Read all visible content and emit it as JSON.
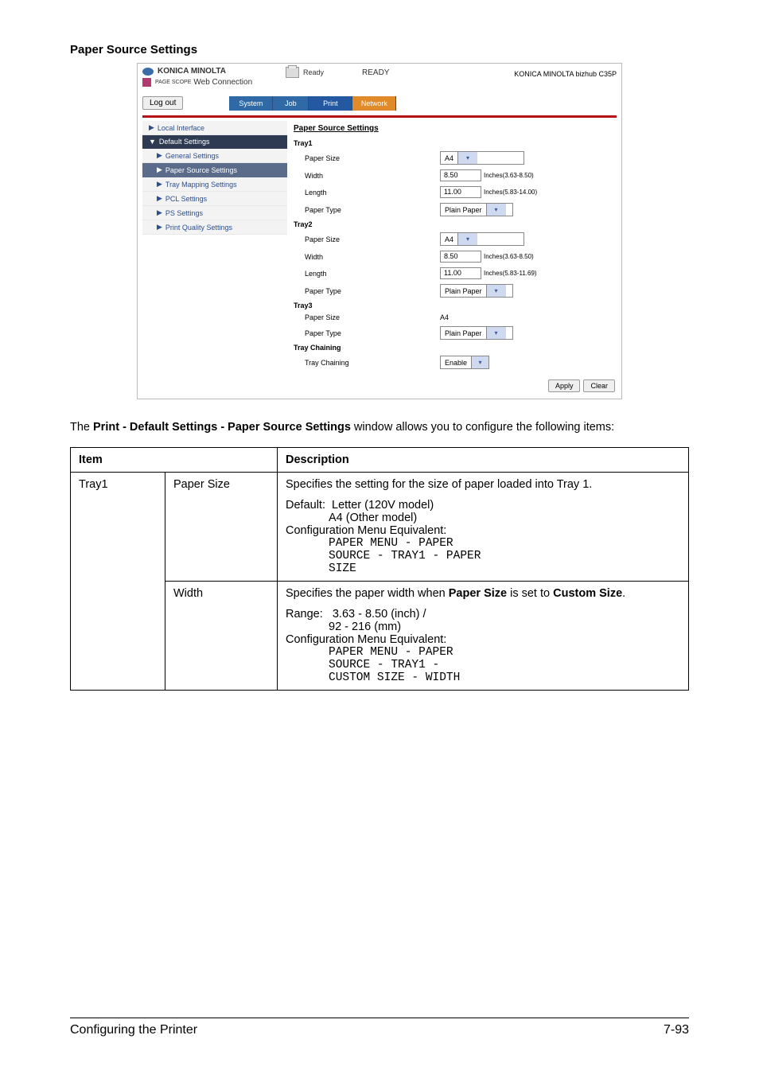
{
  "heading": "Paper Source Settings",
  "shot": {
    "brand": "KONICA MINOLTA",
    "pagescope_label1": "PAGE SCOPE",
    "pagescope_label2": "Web Connection",
    "ready1": "Ready",
    "ready2": "READY",
    "device": "KONICA MINOLTA bizhub C35P",
    "logout": "Log out",
    "tabs": {
      "system": "System",
      "job": "Job",
      "print": "Print",
      "network": "Network"
    },
    "nav": {
      "local": "Local Interface",
      "default": "Default Settings",
      "general": "General Settings",
      "psrc": "Paper Source Settings",
      "traymap": "Tray Mapping Settings",
      "pcl": "PCL Settings",
      "ps": "PS Settings",
      "pq": "Print Quality Settings"
    },
    "sectitle": "Paper Source Settings",
    "groups": {
      "t1": "Tray1",
      "t2": "Tray2",
      "t3": "Tray3",
      "tc": "Tray Chaining"
    },
    "labels": {
      "ps": "Paper Size",
      "w": "Width",
      "l": "Length",
      "pt": "Paper Type",
      "tcf": "Tray Chaining"
    },
    "vals": {
      "a4": "A4",
      "w1": "8.50",
      "w1hint": "Inches(3.63-8.50)",
      "l1": "11.00",
      "l1hint": "Inches(5.83-14.00)",
      "plain": "Plain Paper",
      "w2": "8.50",
      "w2hint": "Inches(3.63-8.50)",
      "l2": "11.00",
      "l2hint": "Inches(5.83-11.69)",
      "enable": "Enable"
    },
    "buttons": {
      "apply": "Apply",
      "clear": "Clear"
    }
  },
  "caption_parts": {
    "p1": "The ",
    "b": "Print - Default Settings - Paper Source Settings",
    "p2": " window allows you to configure the following items:"
  },
  "table": {
    "header": {
      "item": "Item",
      "desc": "Description"
    },
    "row1": {
      "c1": "Tray1",
      "c2": "Paper Size",
      "d1": "Specifies the setting for the size of paper loaded into Tray 1.",
      "def_lead": "Default:",
      "def1": "Letter (120V model)",
      "def2": "A4 (Other model)",
      "cfg": "Configuration Menu Equivalent:",
      "m1": "PAPER MENU - PAPER",
      "m2": "SOURCE - TRAY1 - PAPER",
      "m3": "SIZE"
    },
    "row2": {
      "c2": "Width",
      "d1a": "Specifies the paper width when ",
      "d1b": "Paper Size",
      "d1c": " is set to ",
      "d1d": "Custom Size",
      "d1e": ".",
      "rng_lead": "Range:",
      "r1": "3.63 - 8.50 (inch) /",
      "r2": "92 - 216 (mm)",
      "cfg": "Configuration Menu Equivalent:",
      "m1": "PAPER MENU - PAPER",
      "m2": "SOURCE - TRAY1 -",
      "m3": "CUSTOM SIZE - WIDTH"
    }
  },
  "footer": {
    "left": "Configuring the Printer",
    "right": "7-93"
  }
}
